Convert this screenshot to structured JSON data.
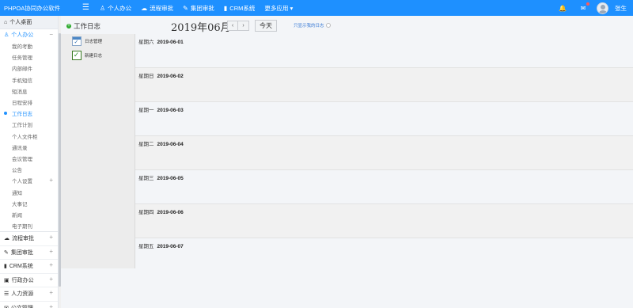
{
  "topbar": {
    "brand": "PHPOA协同办公软件",
    "nav": [
      {
        "icon": "person-icon",
        "glyph": "♙",
        "label": "个人办公"
      },
      {
        "icon": "workflow-icon",
        "glyph": "☁",
        "label": "流程审批"
      },
      {
        "icon": "edit-icon",
        "glyph": "✎",
        "label": "集团审批"
      },
      {
        "icon": "bar-chart-icon",
        "glyph": "▮",
        "label": "CRM系统"
      },
      {
        "icon": "",
        "glyph": "",
        "label": "更多应用 ▾"
      }
    ],
    "bell_glyph": "🔔",
    "chat_glyph": "✉",
    "username": "张生"
  },
  "sidebar": {
    "home": "个人桌面",
    "home_icon": "⌂",
    "personal_group": "个人办公",
    "personal_icon": "♙",
    "personal_sign": "−",
    "personal_items": [
      {
        "label": "我的考勤"
      },
      {
        "label": "任务管理"
      },
      {
        "label": "内部邮件"
      },
      {
        "label": "手机短信"
      },
      {
        "label": "短消息"
      },
      {
        "label": "日程安排"
      },
      {
        "label": "工作日志",
        "active": true
      },
      {
        "label": "工作计划"
      },
      {
        "label": "个人文件柜"
      },
      {
        "label": "通讯录"
      },
      {
        "label": "会议管理"
      },
      {
        "label": "公告"
      },
      {
        "label": "个人设置",
        "sign": "+"
      },
      {
        "label": "通知"
      },
      {
        "label": "大事记"
      },
      {
        "label": "新闻"
      },
      {
        "label": "电子期刊"
      }
    ],
    "groups": [
      {
        "icon": "☁",
        "label": "流程审批",
        "sign": "+"
      },
      {
        "icon": "✎",
        "label": "集团审批",
        "sign": "+"
      },
      {
        "icon": "▮",
        "label": "CRM系统",
        "sign": "+"
      },
      {
        "icon": "▣",
        "label": "行政办公",
        "sign": "+"
      },
      {
        "icon": "☰",
        "label": "人力资源",
        "sign": "+"
      },
      {
        "icon": "✉",
        "label": "公文管理",
        "sign": "+"
      }
    ]
  },
  "content": {
    "title": "工作日志",
    "month": "2019年06月",
    "prev": "‹",
    "next": "›",
    "today": "今天",
    "only_mine": "只显示我的日志"
  },
  "leftpanel": {
    "manage": "日志管理",
    "new_log": "新建日志",
    "new_glyph": "✓"
  },
  "days": [
    {
      "weekday": "星期六",
      "date": "2019-06-01"
    },
    {
      "weekday": "星期日",
      "date": "2019-06-02"
    },
    {
      "weekday": "星期一",
      "date": "2019-06-03"
    },
    {
      "weekday": "星期二",
      "date": "2019-06-04"
    },
    {
      "weekday": "星期三",
      "date": "2019-06-05"
    },
    {
      "weekday": "星期四",
      "date": "2019-06-06"
    },
    {
      "weekday": "星期五",
      "date": "2019-06-07"
    }
  ]
}
